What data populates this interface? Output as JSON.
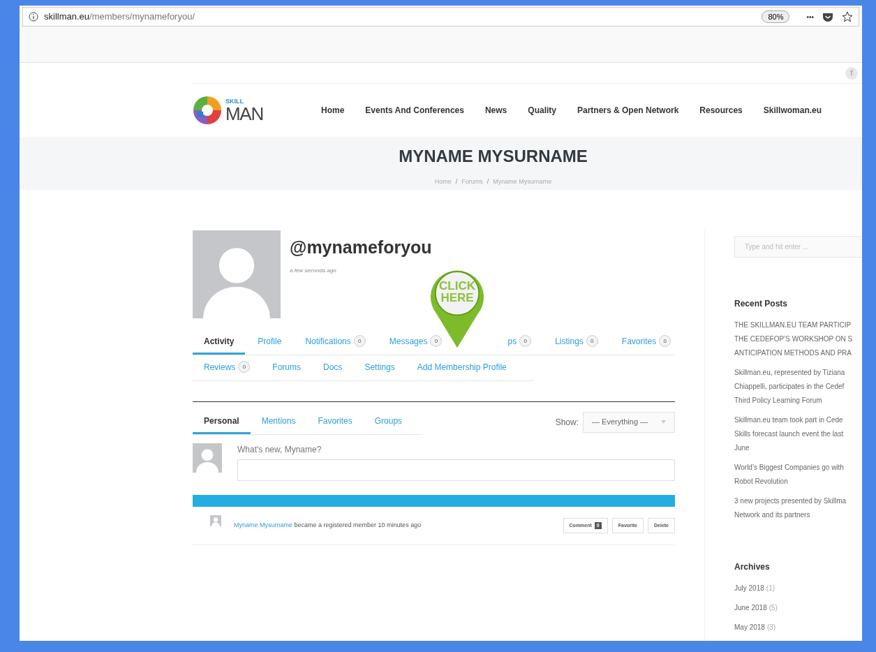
{
  "browser": {
    "url_host": "skillman.eu",
    "url_path": "/members/mynameforyou/",
    "zoom": "80%",
    "menu_dots": "•••"
  },
  "social": {
    "facebook": "f"
  },
  "logo": {
    "top": "SKILL",
    "bottom": "MAN"
  },
  "nav": [
    {
      "label": "Home"
    },
    {
      "label": "Events And Conferences"
    },
    {
      "label": "News"
    },
    {
      "label": "Quality"
    },
    {
      "label": "Partners & Open Network"
    },
    {
      "label": "Resources"
    },
    {
      "label": "Skillwoman.eu"
    }
  ],
  "page_title": "MYNAME MYSURNAME",
  "breadcrumb": [
    "Home",
    "Forums",
    "Myname Mysurname"
  ],
  "breadcrumb_separator": "/",
  "profile": {
    "handle": "@mynameforyou",
    "last_active": "a few seconds ago"
  },
  "tabs_row_1": [
    {
      "label": "Activity",
      "selected": true
    },
    {
      "label": "Profile",
      "selected": false
    },
    {
      "label": "Notifications",
      "count": "0",
      "selected": false
    },
    {
      "label": "Messages",
      "count": "0",
      "selected": false
    },
    {
      "label": "ps",
      "count": "0",
      "selected": false
    },
    {
      "label": "Listings",
      "count": "0",
      "selected": false
    },
    {
      "label": "Favorites",
      "count": "0",
      "selected": false
    }
  ],
  "tabs_row_2": [
    {
      "label": "Reviews",
      "count": "0",
      "selected": false
    },
    {
      "label": "Forums",
      "selected": false
    },
    {
      "label": "Docs",
      "selected": false
    },
    {
      "label": "Settings",
      "selected": false
    },
    {
      "label": "Add Membership Profile",
      "selected": false
    }
  ],
  "pin": {
    "line_1": "CLICK",
    "line_2": "HERE"
  },
  "subtabs": [
    {
      "label": "Personal",
      "selected": true
    },
    {
      "label": "Mentions",
      "selected": false
    },
    {
      "label": "Favorites",
      "selected": false
    },
    {
      "label": "Groups",
      "selected": false
    }
  ],
  "show_filter": {
    "label": "Show:",
    "value": "— Everything —"
  },
  "post_form": {
    "prompt": "What's new, Myname?"
  },
  "activity": [
    {
      "user": "Myname Mysurname",
      "text": "became a registered member 10 minutes ago",
      "buttons": [
        {
          "label": "Comment",
          "count": "0"
        },
        {
          "label": "Favorite"
        },
        {
          "label": "Delete"
        }
      ]
    }
  ],
  "sidebar": {
    "search_placeholder": "Type and hit enter ...",
    "recent_posts_title": "Recent Posts",
    "recent_posts": [
      {
        "lines": [
          "THE SKILLMAN.EU TEAM PARTICIP",
          "THE CEDEFOP’S WORKSHOP ON S",
          "ANTICIPATION METHODS AND PRA"
        ]
      },
      {
        "lines": [
          "Skillman.eu, represented by Tiziana",
          "Chiappelli, participates in the Cedef",
          "Third Policy Learning Forum"
        ]
      },
      {
        "lines": [
          "Skillman.eu team took part in Cede",
          "Skills forecast launch event the last",
          "June"
        ]
      },
      {
        "lines": [
          "World’s Biggest Companies go with",
          "Robot Revolution"
        ]
      },
      {
        "lines": [
          "3 new projects presented by Skillma",
          "Network and its partners"
        ]
      }
    ],
    "archives_title": "Archives",
    "archives": [
      {
        "label": "July 2018",
        "count": "(1)"
      },
      {
        "label": "June 2018",
        "count": "(5)"
      },
      {
        "label": "May 2018",
        "count": "(3)"
      }
    ]
  }
}
